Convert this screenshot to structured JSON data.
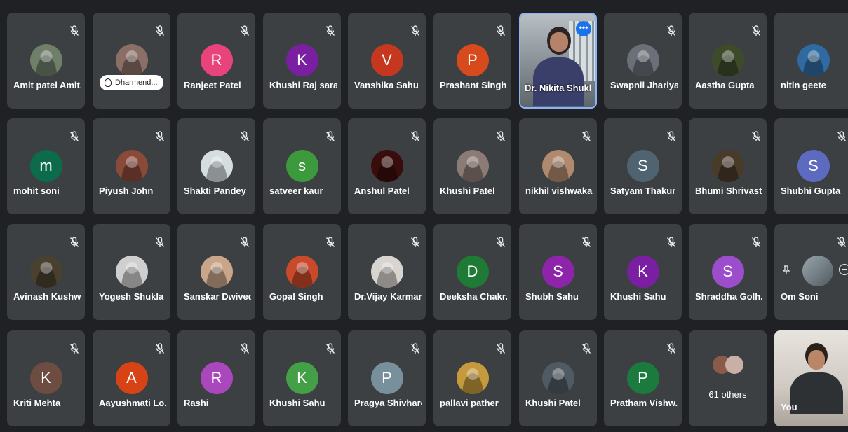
{
  "colors": {
    "tile_bg": "#3c4043",
    "page_bg": "#202124",
    "speaking_border": "#8ab4f8",
    "more_button": "#1a73e8"
  },
  "icons": {
    "mic_off": "mic-off-icon",
    "more": "more-options-icon",
    "pin": "pin-icon",
    "remove": "remove-icon",
    "pill": "hand-icon"
  },
  "participants": [
    {
      "name": "Amit patel Amit...",
      "type": "photo",
      "avatar_color": "#6f7f6a",
      "muted": true
    },
    {
      "name": "Dharmend...",
      "type": "photo",
      "avatar_color": "#8b6f66",
      "muted": true,
      "pill": true
    },
    {
      "name": "Ranjeet Patel",
      "type": "letter",
      "letter": "R",
      "avatar_color": "#e8437a",
      "muted": true
    },
    {
      "name": "Khushi Raj saraf",
      "type": "letter",
      "letter": "K",
      "avatar_color": "#7b1fa2",
      "muted": true
    },
    {
      "name": "Vanshika Sahu",
      "type": "letter",
      "letter": "V",
      "avatar_color": "#c5381f",
      "muted": true
    },
    {
      "name": "Prashant Singh",
      "type": "letter",
      "letter": "P",
      "avatar_color": "#d74a1b",
      "muted": true
    },
    {
      "name": "Dr. Nikita Shukla",
      "type": "video",
      "speaking": true,
      "more": "•••"
    },
    {
      "name": "Swapnil Jhariya",
      "type": "photo",
      "avatar_color": "#6a6f78",
      "muted": true
    },
    {
      "name": "Aastha Gupta",
      "type": "photo",
      "avatar_color": "#3d4b2b",
      "muted": true
    },
    {
      "name": "nitin geete",
      "type": "photo",
      "avatar_color": "#2f6aa0",
      "muted": false
    },
    {
      "name": "mohit soni",
      "type": "letter",
      "letter": "m",
      "avatar_color": "#0b6b4a",
      "muted": true
    },
    {
      "name": "Piyush John",
      "type": "photo",
      "avatar_color": "#8a4a3a",
      "muted": true
    },
    {
      "name": "Shakti Pandey",
      "type": "photo",
      "avatar_color": "#d6dde0",
      "muted": true
    },
    {
      "name": "satveer kaur",
      "type": "letter",
      "letter": "s",
      "avatar_color": "#3c9a3c",
      "muted": true
    },
    {
      "name": "Anshul Patel",
      "type": "photo",
      "avatar_color": "#3a0d0d",
      "muted": true
    },
    {
      "name": "Khushi Patel",
      "type": "photo",
      "avatar_color": "#8c7a74",
      "muted": true
    },
    {
      "name": "nikhil vishwaka...",
      "type": "photo",
      "avatar_color": "#b08a6e",
      "muted": true
    },
    {
      "name": "Satyam Thakur",
      "type": "letter",
      "letter": "S",
      "avatar_color": "#4f6470",
      "muted": true
    },
    {
      "name": "Bhumi Shrivast...",
      "type": "photo",
      "avatar_color": "#4a3a2a",
      "muted": true
    },
    {
      "name": "Shubhi Gupta",
      "type": "letter",
      "letter": "S",
      "avatar_color": "#5c6bc0",
      "muted": true
    },
    {
      "name": "Avinash Kushw...",
      "type": "photo",
      "avatar_color": "#4a4030",
      "muted": true
    },
    {
      "name": "Yogesh Shukla",
      "type": "photo",
      "avatar_color": "#cfcfcf",
      "muted": true
    },
    {
      "name": "Sanskar Dwivedi",
      "type": "photo",
      "avatar_color": "#c9a58a",
      "muted": true
    },
    {
      "name": "Gopal Singh",
      "type": "photo",
      "avatar_color": "#c84a2a",
      "muted": true
    },
    {
      "name": "Dr.Vijay Karmar...",
      "type": "photo",
      "avatar_color": "#d8d4cf",
      "muted": true
    },
    {
      "name": "Deeksha Chakr...",
      "type": "letter",
      "letter": "D",
      "avatar_color": "#1e7a34",
      "muted": true
    },
    {
      "name": "Shubh Sahu",
      "type": "letter",
      "letter": "S",
      "avatar_color": "#8e24aa",
      "muted": true
    },
    {
      "name": "Khushi Sahu",
      "type": "letter",
      "letter": "K",
      "avatar_color": "#7b1fa2",
      "muted": true
    },
    {
      "name": "Shraddha Golh...",
      "type": "letter",
      "letter": "S",
      "avatar_color": "#9c4dcc",
      "muted": true
    },
    {
      "name": "Om Soni",
      "type": "hover",
      "muted": true
    },
    {
      "name": "Kriti Mehta",
      "type": "letter",
      "letter": "K",
      "avatar_color": "#6d4c41",
      "muted": true
    },
    {
      "name": "Aayushmati Lo...",
      "type": "letter",
      "letter": "A",
      "avatar_color": "#d84315",
      "muted": true
    },
    {
      "name": "Rashi",
      "type": "letter",
      "letter": "R",
      "avatar_color": "#ab47bc",
      "muted": true
    },
    {
      "name": "Khushi Sahu",
      "type": "letter",
      "letter": "K",
      "avatar_color": "#43a047",
      "muted": true
    },
    {
      "name": "Pragya Shivhare",
      "type": "letter",
      "letter": "P",
      "avatar_color": "#78909c",
      "muted": true
    },
    {
      "name": "pallavi pather",
      "type": "photo",
      "avatar_color": "#c59a3c",
      "muted": true
    },
    {
      "name": "Khushi Patel",
      "type": "photo",
      "avatar_color": "#505a62",
      "muted": true
    },
    {
      "name": "Pratham Vishw...",
      "type": "letter",
      "letter": "P",
      "avatar_color": "#1b7a3e",
      "muted": true
    },
    {
      "name": "61 others",
      "type": "others"
    },
    {
      "name": "You",
      "type": "self"
    }
  ]
}
